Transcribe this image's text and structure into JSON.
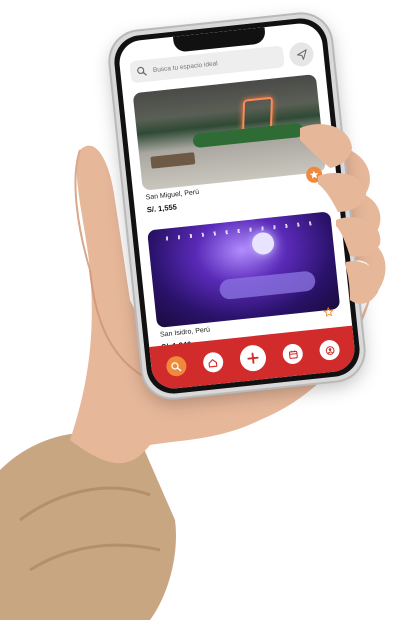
{
  "search": {
    "placeholder": "Busca tu espacio ideal"
  },
  "listings": [
    {
      "location": "San Miguel, Perú",
      "price": "S/. 1,555",
      "favorite": true
    },
    {
      "location": "San Isidro, Perú",
      "price": "S/. 1,240",
      "favorite": false
    }
  ],
  "colors": {
    "accent": "#f08a3a",
    "nav": "#d22b2b"
  },
  "icons": {
    "search": "search-icon",
    "send": "send-icon",
    "star": "star-icon",
    "nav": [
      "search-icon",
      "home-icon",
      "plus-icon",
      "calendar-icon",
      "user-icon"
    ]
  }
}
